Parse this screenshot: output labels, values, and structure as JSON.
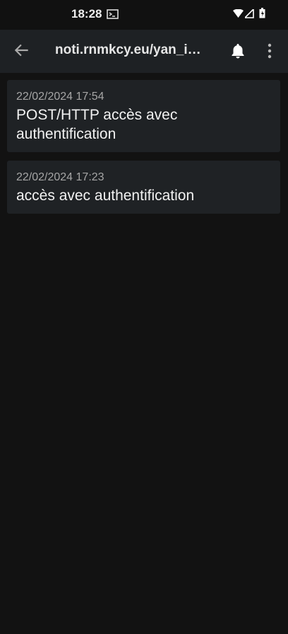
{
  "status_bar": {
    "time": "18:28"
  },
  "app_bar": {
    "title": "noti.rnmkcy.eu/yan_i…"
  },
  "messages": [
    {
      "date": "22/02/2024 17:54",
      "text": "POST/HTTP accès avec authentification"
    },
    {
      "date": "22/02/2024 17:23",
      "text": "accès avec authentification"
    }
  ]
}
